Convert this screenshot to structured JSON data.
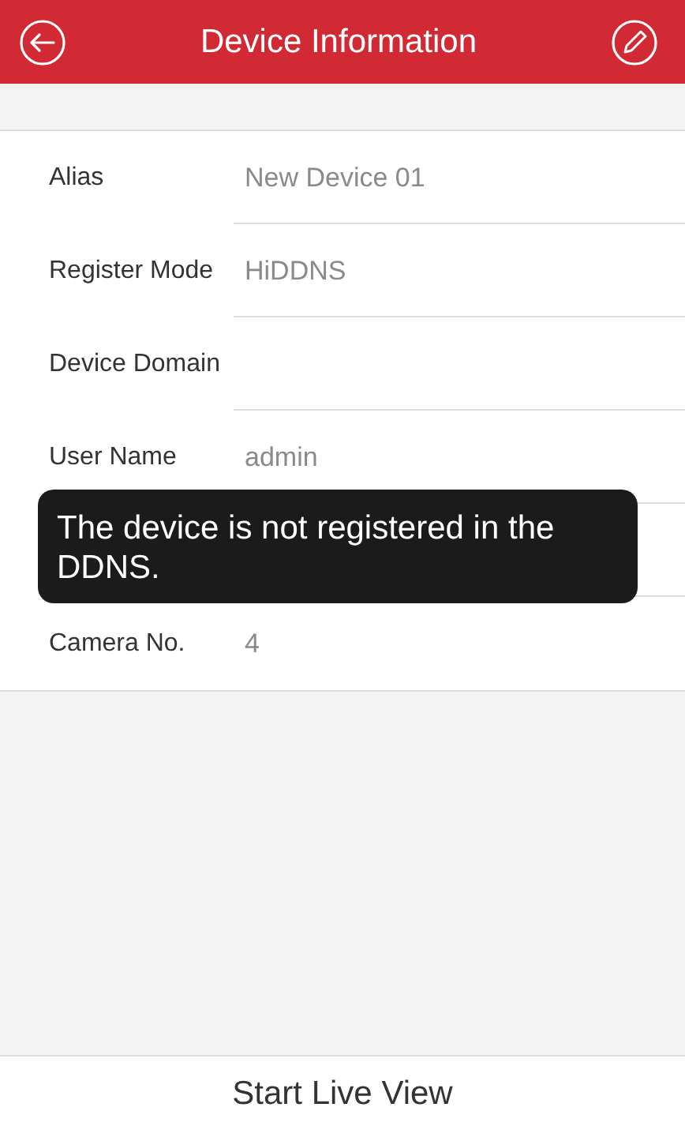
{
  "header": {
    "title": "Device Information"
  },
  "fields": [
    {
      "label": "Alias",
      "value": "New Device 01"
    },
    {
      "label": "Register Mode",
      "value": "HiDDNS"
    },
    {
      "label": "Device Domain"
    },
    {
      "label": "User Name",
      "value": "admin"
    },
    {
      "kind": "toast",
      "text": "The device is not registered in the DDNS."
    },
    {
      "label": "Camera No.",
      "value": "4"
    }
  ],
  "footer_button": "Start Live View"
}
